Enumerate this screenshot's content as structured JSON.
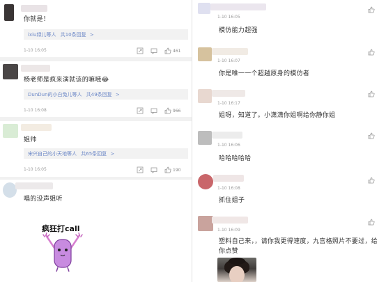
{
  "colors": {
    "link": "#6b87c7",
    "meta": "#9a9a9a",
    "text": "#333333",
    "left_bg": "#f1f1f1"
  },
  "left": {
    "comments": [
      {
        "text": "你就是！",
        "time": "",
        "reply": {
          "user": "ixiu绿儿等人",
          "count": "共10条回复"
        },
        "date": "1-10 16:05",
        "likes": "461"
      },
      {
        "text": "杨老师是疯来演就该的嘛哦😂",
        "reply": {
          "user": "DunDun的小白兔儿等人",
          "count": "共49条回复"
        },
        "date": "1-10 16:08",
        "likes": "966"
      },
      {
        "text": "姐帅",
        "reply": {
          "user": "宋兴自己的小天地等人",
          "count": "共65条回复"
        },
        "date": "1-10 16:05",
        "likes": "190"
      },
      {
        "text": "唱的没声姐听"
      }
    ],
    "sticker": {
      "caption": "疯狂打call",
      "icon": "cheering-character-icon"
    }
  },
  "right": {
    "comments": [
      {
        "time": "1-10 16:05",
        "text": "模仿能力超强",
        "likes": ""
      },
      {
        "time": "1-10 16:07",
        "text": "你是唯一一个超越原身的模仿者",
        "likes": ""
      },
      {
        "time": "1-10 16:17",
        "text": "姐呀，知道了。小潇潇你姐啊给你静你姐",
        "likes": ""
      },
      {
        "time": "1-10 16:06",
        "text": "哈哈哈哈哈",
        "likes": ""
      },
      {
        "time": "1-10 16:08",
        "text": "抓住姐子",
        "likes": ""
      },
      {
        "time": "1-10 16:09",
        "text": "塑料自己来，，请你我更得速度，九宫格照片不要过，给你点赞",
        "likes": ""
      }
    ]
  }
}
